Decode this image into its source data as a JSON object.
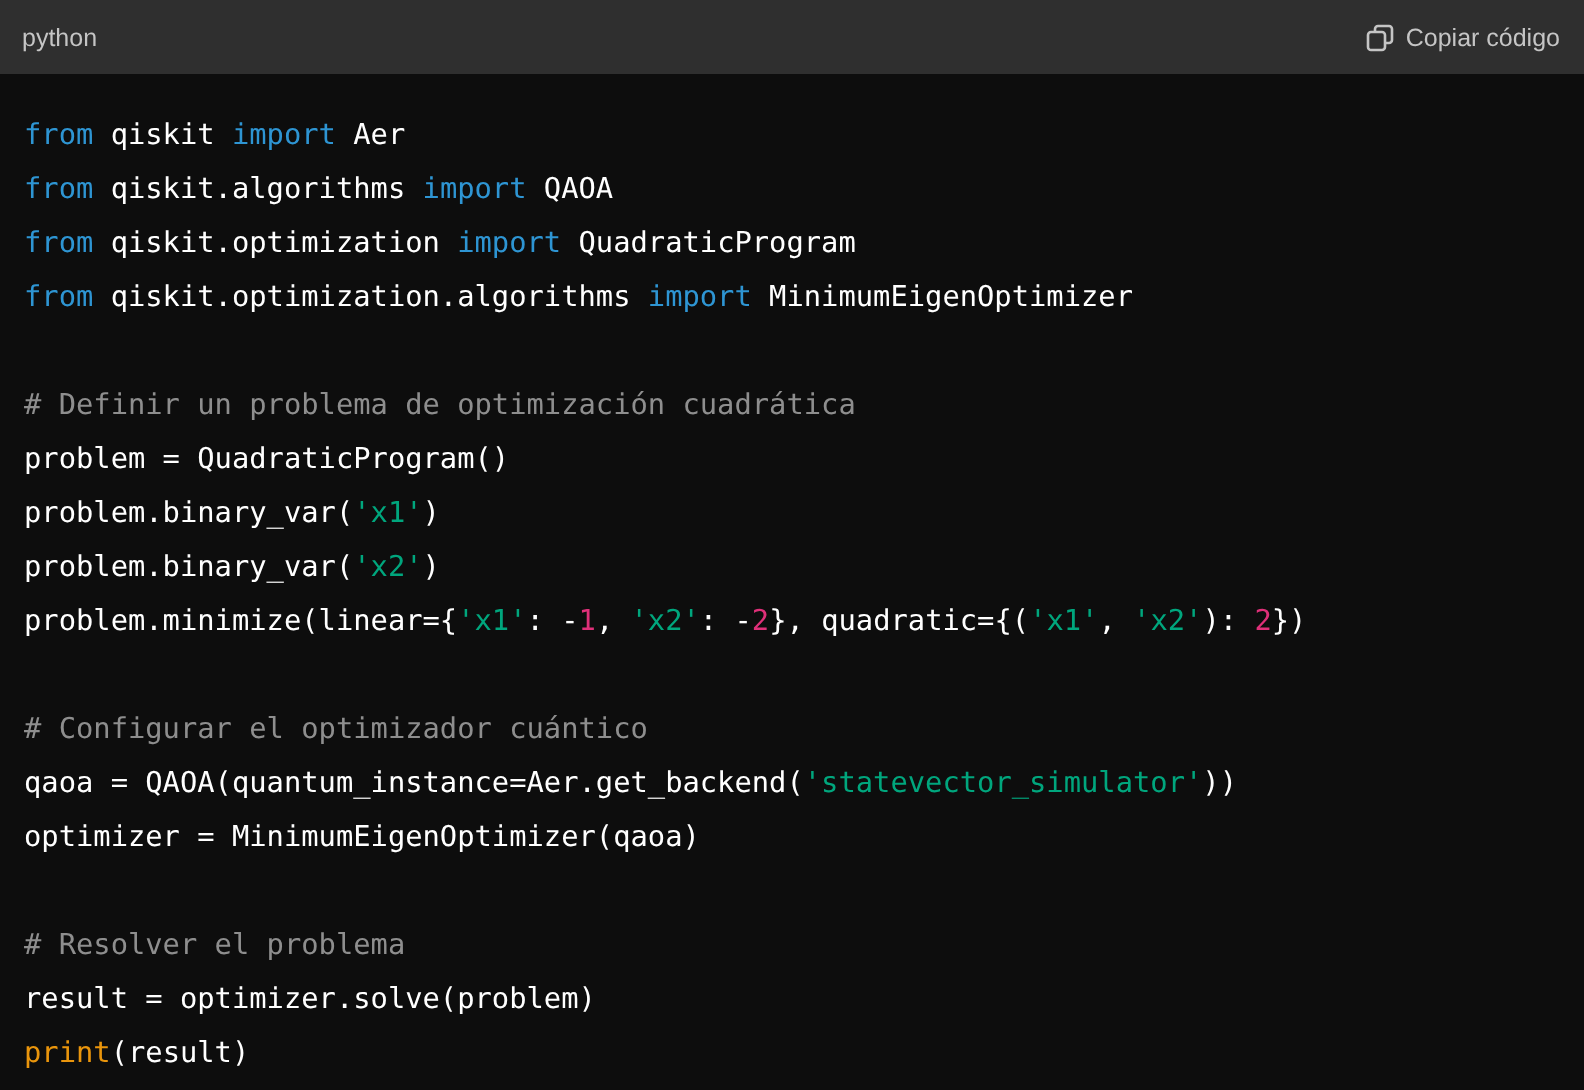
{
  "header": {
    "language": "python",
    "copy_button": "Copiar código"
  },
  "lines": [
    {
      "kind": "code",
      "tokens": [
        {
          "kind": "keyword",
          "text": "from"
        },
        {
          "kind": "plain",
          "text": " qiskit "
        },
        {
          "kind": "keyword",
          "text": "import"
        },
        {
          "kind": "plain",
          "text": " Aer"
        }
      ]
    },
    {
      "kind": "code",
      "tokens": [
        {
          "kind": "keyword",
          "text": "from"
        },
        {
          "kind": "plain",
          "text": " qiskit.algorithms "
        },
        {
          "kind": "keyword",
          "text": "import"
        },
        {
          "kind": "plain",
          "text": " QAOA"
        }
      ]
    },
    {
      "kind": "code",
      "tokens": [
        {
          "kind": "keyword",
          "text": "from"
        },
        {
          "kind": "plain",
          "text": " qiskit.optimization "
        },
        {
          "kind": "keyword",
          "text": "import"
        },
        {
          "kind": "plain",
          "text": " QuadraticProgram"
        }
      ]
    },
    {
      "kind": "code",
      "tokens": [
        {
          "kind": "keyword",
          "text": "from"
        },
        {
          "kind": "plain",
          "text": " qiskit.optimization.algorithms "
        },
        {
          "kind": "keyword",
          "text": "import"
        },
        {
          "kind": "plain",
          "text": " MinimumEigenOptimizer"
        }
      ]
    },
    {
      "kind": "blank"
    },
    {
      "kind": "code",
      "tokens": [
        {
          "kind": "comment",
          "text": "# Definir un problema de optimización cuadrática"
        }
      ]
    },
    {
      "kind": "code",
      "tokens": [
        {
          "kind": "plain",
          "text": "problem = QuadraticProgram()"
        }
      ]
    },
    {
      "kind": "code",
      "tokens": [
        {
          "kind": "plain",
          "text": "problem.binary_var("
        },
        {
          "kind": "string",
          "text": "'x1'"
        },
        {
          "kind": "plain",
          "text": ")"
        }
      ]
    },
    {
      "kind": "code",
      "tokens": [
        {
          "kind": "plain",
          "text": "problem.binary_var("
        },
        {
          "kind": "string",
          "text": "'x2'"
        },
        {
          "kind": "plain",
          "text": ")"
        }
      ]
    },
    {
      "kind": "code",
      "tokens": [
        {
          "kind": "plain",
          "text": "problem.minimize(linear={"
        },
        {
          "kind": "string",
          "text": "'x1'"
        },
        {
          "kind": "plain",
          "text": ": -"
        },
        {
          "kind": "number",
          "text": "1"
        },
        {
          "kind": "plain",
          "text": ", "
        },
        {
          "kind": "string",
          "text": "'x2'"
        },
        {
          "kind": "plain",
          "text": ": -"
        },
        {
          "kind": "number",
          "text": "2"
        },
        {
          "kind": "plain",
          "text": "}, quadratic={("
        },
        {
          "kind": "string",
          "text": "'x1'"
        },
        {
          "kind": "plain",
          "text": ", "
        },
        {
          "kind": "string",
          "text": "'x2'"
        },
        {
          "kind": "plain",
          "text": "): "
        },
        {
          "kind": "number",
          "text": "2"
        },
        {
          "kind": "plain",
          "text": "})"
        }
      ]
    },
    {
      "kind": "blank"
    },
    {
      "kind": "code",
      "tokens": [
        {
          "kind": "comment",
          "text": "# Configurar el optimizador cuántico"
        }
      ]
    },
    {
      "kind": "code",
      "tokens": [
        {
          "kind": "plain",
          "text": "qaoa = QAOA(quantum_instance=Aer.get_backend("
        },
        {
          "kind": "string",
          "text": "'statevector_simulator'"
        },
        {
          "kind": "plain",
          "text": "))"
        }
      ]
    },
    {
      "kind": "code",
      "tokens": [
        {
          "kind": "plain",
          "text": "optimizer = MinimumEigenOptimizer(qaoa)"
        }
      ]
    },
    {
      "kind": "blank"
    },
    {
      "kind": "code",
      "tokens": [
        {
          "kind": "comment",
          "text": "# Resolver el problema"
        }
      ]
    },
    {
      "kind": "code",
      "tokens": [
        {
          "kind": "plain",
          "text": "result = optimizer.solve(problem)"
        }
      ]
    },
    {
      "kind": "code",
      "tokens": [
        {
          "kind": "builtin",
          "text": "print"
        },
        {
          "kind": "plain",
          "text": "(result)"
        }
      ]
    }
  ]
}
